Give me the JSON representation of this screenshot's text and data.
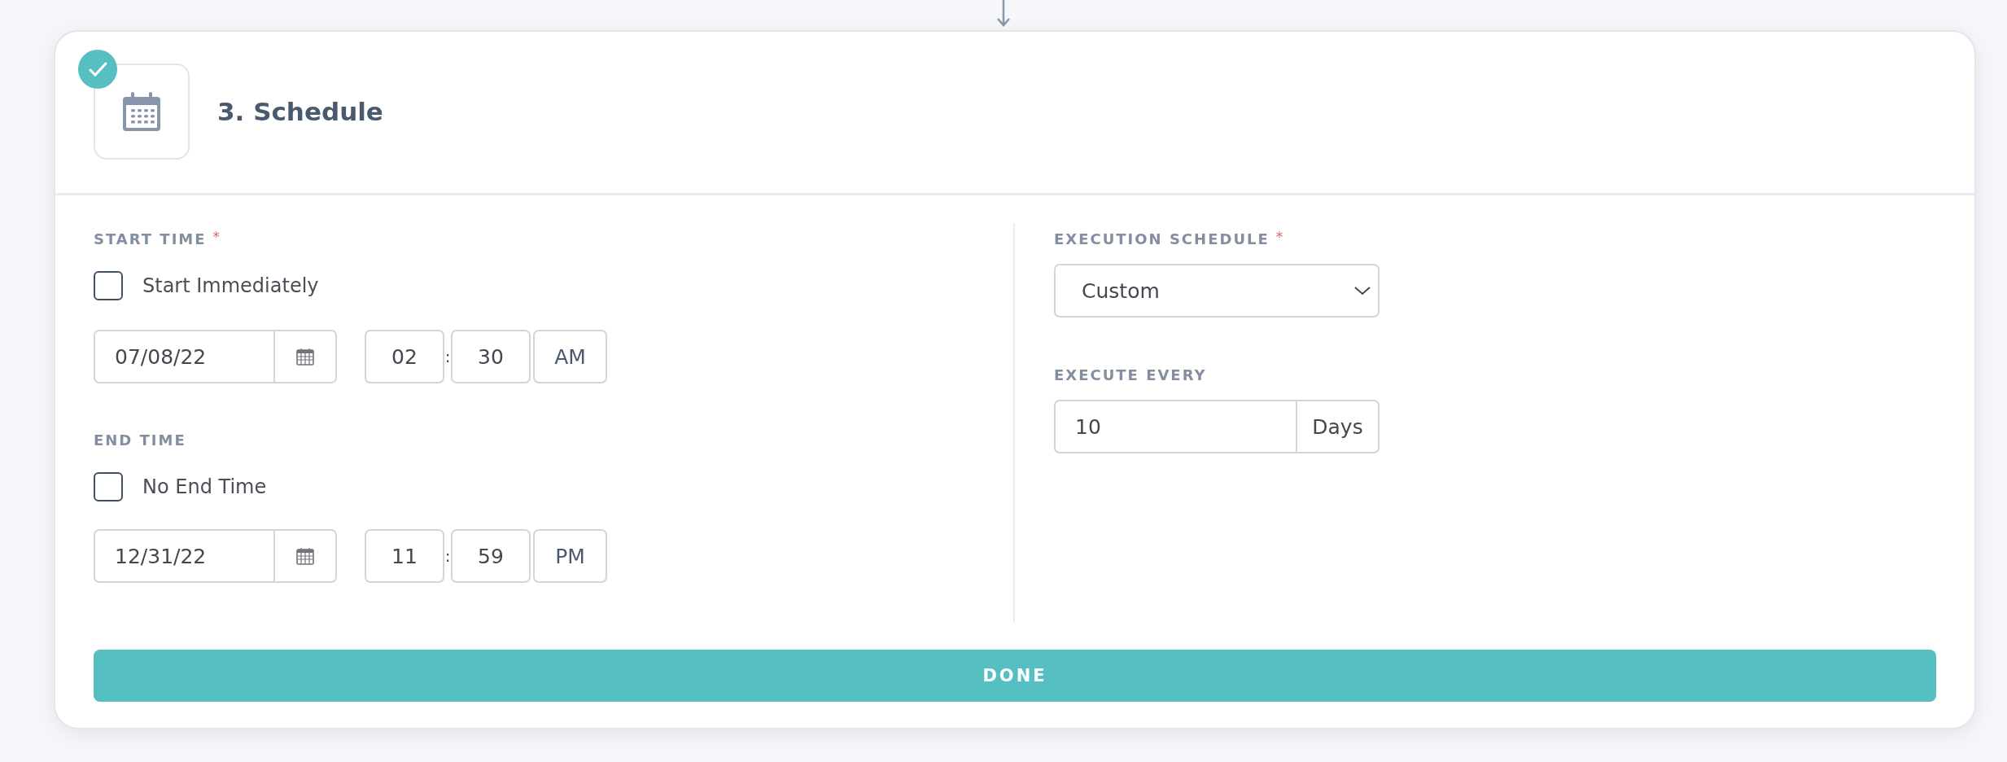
{
  "step": {
    "title": "3. Schedule",
    "completed": true
  },
  "start_time": {
    "label": "START TIME",
    "required_mark": "*",
    "checkbox": {
      "label": "Start Immediately",
      "checked": false
    },
    "date": "07/08/22",
    "hour": "02",
    "separator": ":",
    "minute": "30",
    "period": "AM"
  },
  "end_time": {
    "label": "END TIME",
    "checkbox": {
      "label": "No End Time",
      "checked": false
    },
    "date": "12/31/22",
    "hour": "11",
    "separator": ":",
    "minute": "59",
    "period": "PM"
  },
  "execution_schedule": {
    "label": "EXECUTION SCHEDULE",
    "required_mark": "*",
    "value": "Custom"
  },
  "execute_every": {
    "label": "EXECUTE EVERY",
    "value": "10",
    "unit": "Days"
  },
  "done_button": {
    "label": "DONE"
  }
}
